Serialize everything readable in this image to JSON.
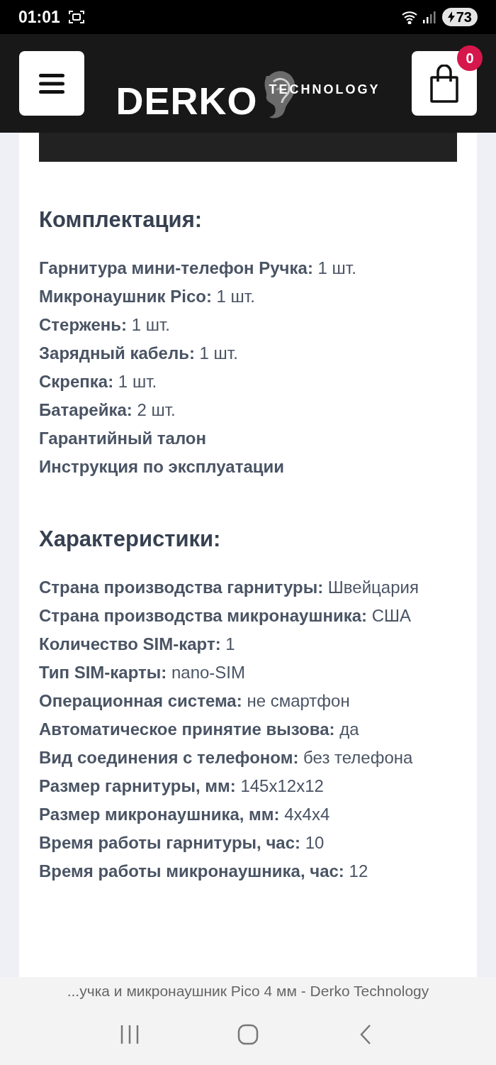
{
  "status_bar": {
    "time": "01:01",
    "battery": "73"
  },
  "header": {
    "logo_main": "DERKO",
    "logo_sub": "TECHNOLOGY",
    "cart_count": "0"
  },
  "sections": [
    {
      "title": "Комплектация:",
      "lines": [
        "**Гарнитура мини-телефон Ручка:** 1 шт.",
        "**Микронаушник Pico:** 1 шт.",
        "**Стержень:** 1 шт.",
        "**Зарядный кабель:** 1 шт.",
        "**Скрепка:** 1 шт.",
        "**Батарейка:** 2 шт.",
        "**Гарантийный талон**",
        "**Инструкция по эксплуатации**"
      ]
    },
    {
      "title": "Характеристики:",
      "lines": [
        "**Страна производства гарнитуры:** Швейцария",
        "**Страна производства микронаушника:** США",
        "**Количество SIM-карт:** 1",
        "**Тип SIM-карты:** nano-SIM",
        "**Операционная система:** не смартфон",
        "**Автоматическое принятие вызова:** да",
        "**Вид соединения с телефоном:** без телефона",
        "**Размер гарнитуры, мм:** 145x12x12",
        "**Размер микронаушника, мм:** 4x4x4",
        "**Время работы гарнитуры, час:** 10",
        "**Время работы микронаушника, час:** 12"
      ]
    }
  ],
  "browser_bar": {
    "page_title": "...учка и микронаушник Pico 4 мм - Derko Technology"
  }
}
